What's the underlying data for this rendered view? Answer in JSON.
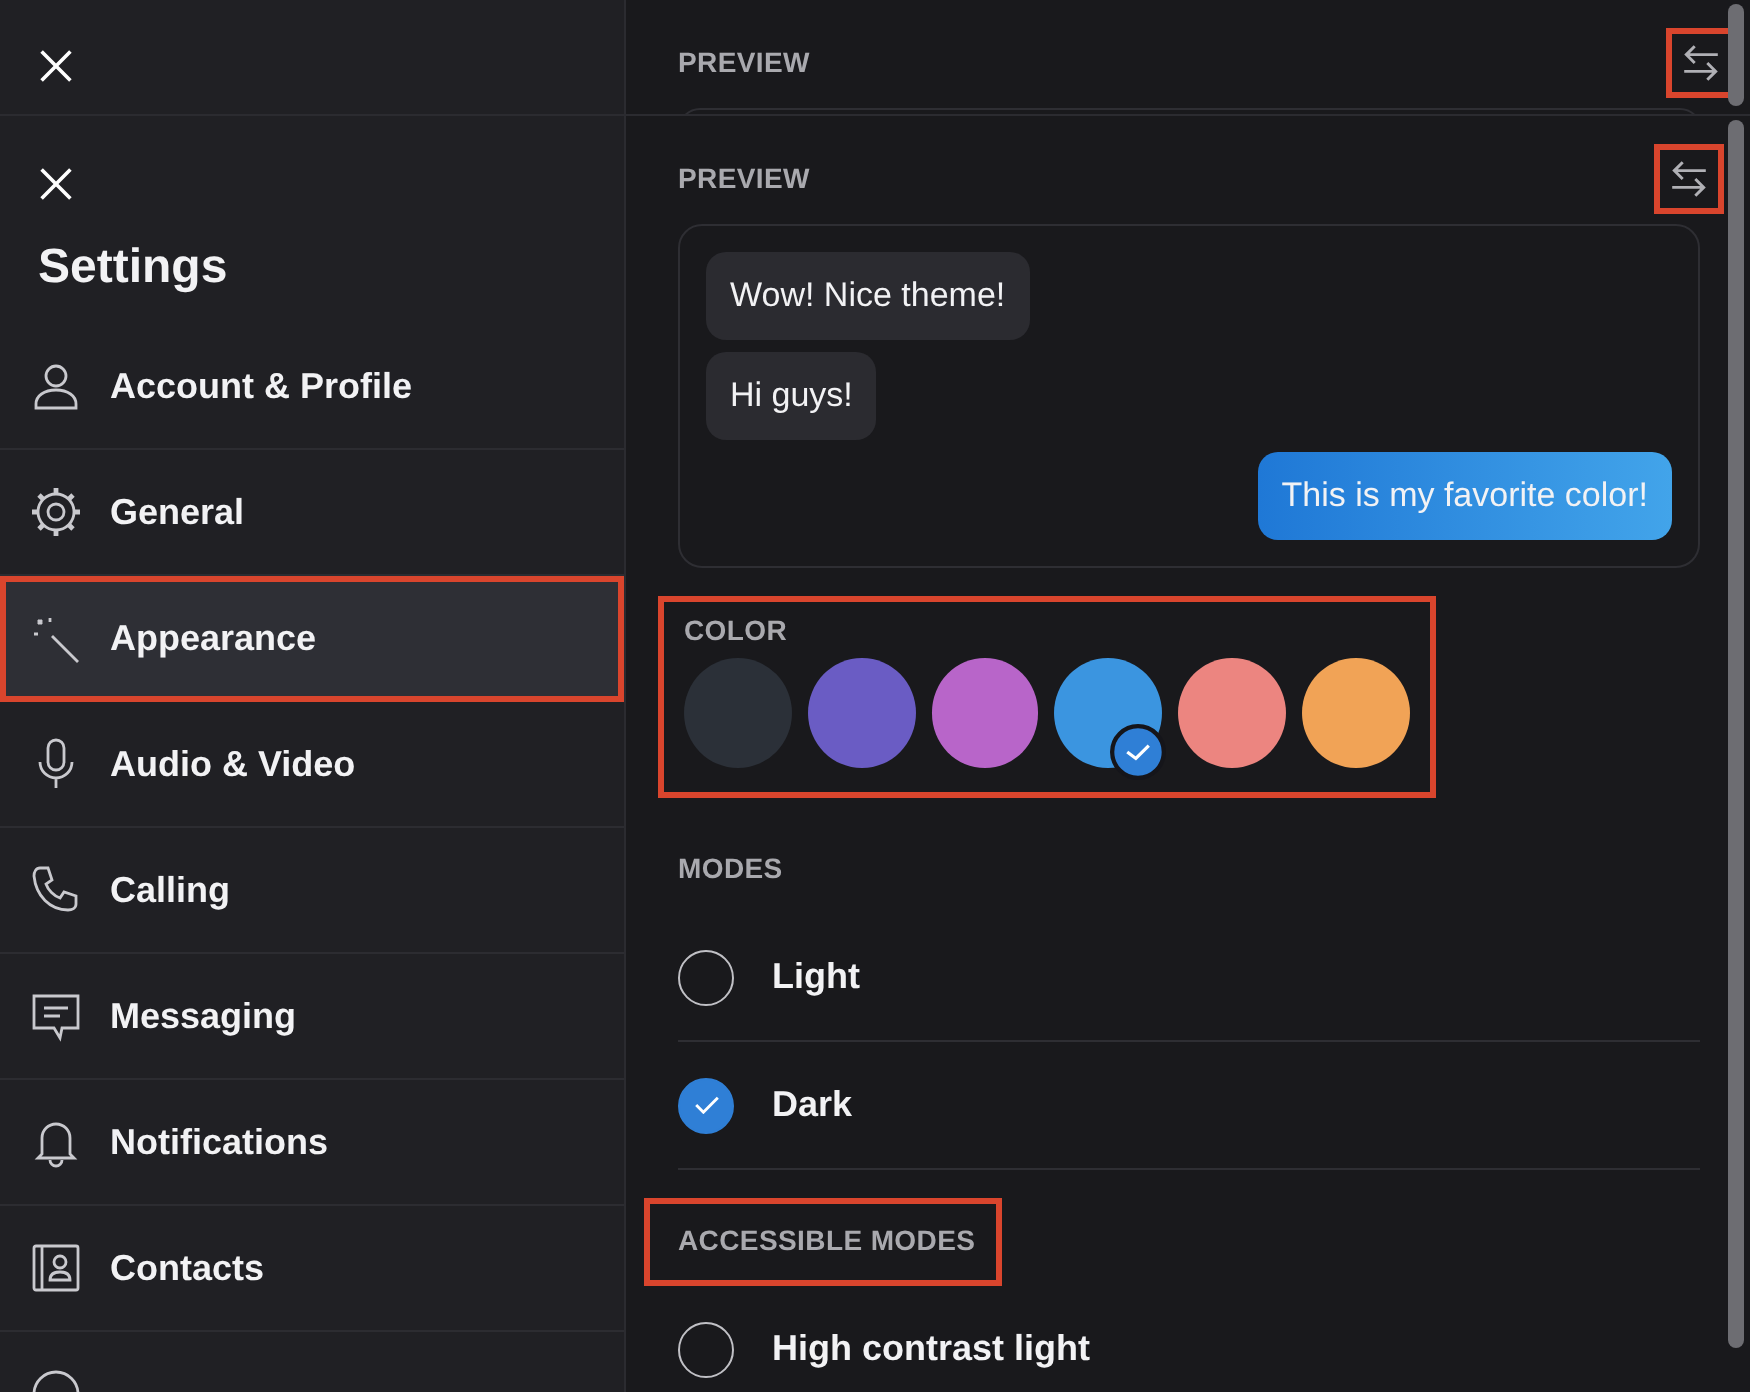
{
  "back_layer": {
    "preview_label": "PREVIEW",
    "swap_highlighted": true
  },
  "sidebar": {
    "title": "Settings",
    "items": [
      {
        "label": "Account & Profile",
        "selected": false,
        "highlighted": false
      },
      {
        "label": "General",
        "selected": false,
        "highlighted": false
      },
      {
        "label": "Appearance",
        "selected": true,
        "highlighted": true
      },
      {
        "label": "Audio & Video",
        "selected": false,
        "highlighted": false
      },
      {
        "label": "Calling",
        "selected": false,
        "highlighted": false
      },
      {
        "label": "Messaging",
        "selected": false,
        "highlighted": false
      },
      {
        "label": "Notifications",
        "selected": false,
        "highlighted": false
      },
      {
        "label": "Contacts",
        "selected": false,
        "highlighted": false
      }
    ]
  },
  "preview": {
    "label": "PREVIEW",
    "swap_highlighted": true,
    "messages": [
      {
        "text": "Wow! Nice theme!",
        "outgoing": false
      },
      {
        "text": "Hi guys!",
        "outgoing": false
      },
      {
        "text": "This is my favorite color!",
        "outgoing": true
      }
    ]
  },
  "color": {
    "label": "COLOR",
    "highlighted": true,
    "swatches": [
      {
        "color": "#2b3038",
        "selected": false
      },
      {
        "color": "#6a5cc4",
        "selected": false
      },
      {
        "color": "#b865c9",
        "selected": false
      },
      {
        "color": "#3b95e0",
        "selected": true
      },
      {
        "color": "#ec8580",
        "selected": false
      },
      {
        "color": "#f1a356",
        "selected": false
      }
    ]
  },
  "modes": {
    "label": "MODES",
    "highlighted": false,
    "options": [
      {
        "label": "Light",
        "selected": false
      },
      {
        "label": "Dark",
        "selected": true
      }
    ]
  },
  "accessible_modes": {
    "label": "ACCESSIBLE MODES",
    "highlighted": true,
    "options": [
      {
        "label": "High contrast light",
        "selected": false
      }
    ]
  }
}
